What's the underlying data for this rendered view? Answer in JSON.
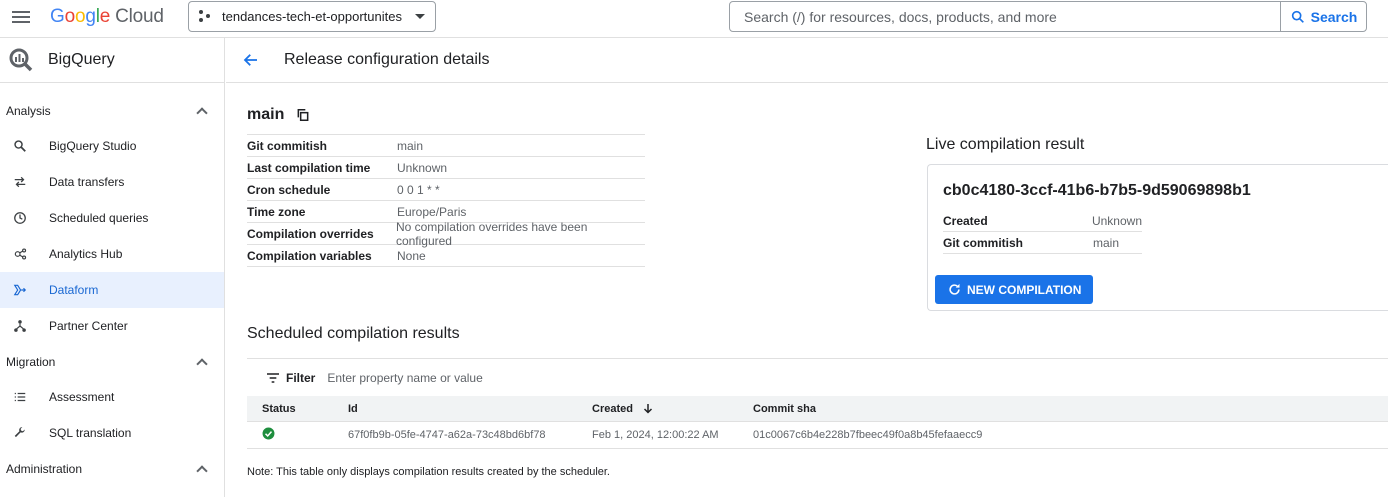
{
  "topbar": {
    "logo": {
      "g1": "G",
      "g2": "o",
      "g3": "o",
      "g4": "g",
      "g5": "l",
      "g6": "e",
      "cloud": "Cloud"
    },
    "project": "tendances-tech-et-opportunites",
    "search_placeholder": "Search (/) for resources, docs, products, and more",
    "search_button": "Search"
  },
  "sidebar": {
    "product": "BigQuery",
    "sections": {
      "analysis": "Analysis",
      "migration": "Migration",
      "administration": "Administration"
    },
    "items": {
      "studio": "BigQuery Studio",
      "transfers": "Data transfers",
      "scheduled": "Scheduled queries",
      "hub": "Analytics Hub",
      "dataform": "Dataform",
      "partner": "Partner Center",
      "assessment": "Assessment",
      "sql": "SQL translation"
    }
  },
  "page": {
    "title": "Release configuration details",
    "config_name": "main",
    "details": [
      {
        "k": "Git commitish",
        "v": "main"
      },
      {
        "k": "Last compilation time",
        "v": "Unknown"
      },
      {
        "k": "Cron schedule",
        "v": "0 0 1 * *"
      },
      {
        "k": "Time zone",
        "v": "Europe/Paris"
      },
      {
        "k": "Compilation overrides",
        "v": "No compilation overrides have been configured"
      },
      {
        "k": "Compilation variables",
        "v": "None"
      }
    ]
  },
  "live": {
    "title": "Live compilation result",
    "hash": "cb0c4180-3ccf-41b6-b7b5-9d59069898b1",
    "created_label": "Created",
    "created_value": "Unknown",
    "commitish_label": "Git commitish",
    "commitish_value": "main",
    "button": "NEW COMPILATION"
  },
  "scheduled": {
    "title": "Scheduled compilation results",
    "filter_label": "Filter",
    "filter_placeholder": "Enter property name or value",
    "columns": {
      "status": "Status",
      "id": "Id",
      "created": "Created",
      "commit": "Commit sha"
    },
    "rows": [
      {
        "id": "67f0fb9b-05fe-4747-a62a-73c48bd6bf78",
        "created": "Feb 1, 2024, 12:00:22 AM",
        "commit": "01c0067c6b4e228b7fbeec49f0a8b45fefaaecc9"
      }
    ],
    "note": "Note: This table only displays compilation results created by the scheduler."
  },
  "colors": {
    "accent": "#1a73e8",
    "success": "#1e8e3e",
    "active_bg": "#e8f0fe"
  }
}
